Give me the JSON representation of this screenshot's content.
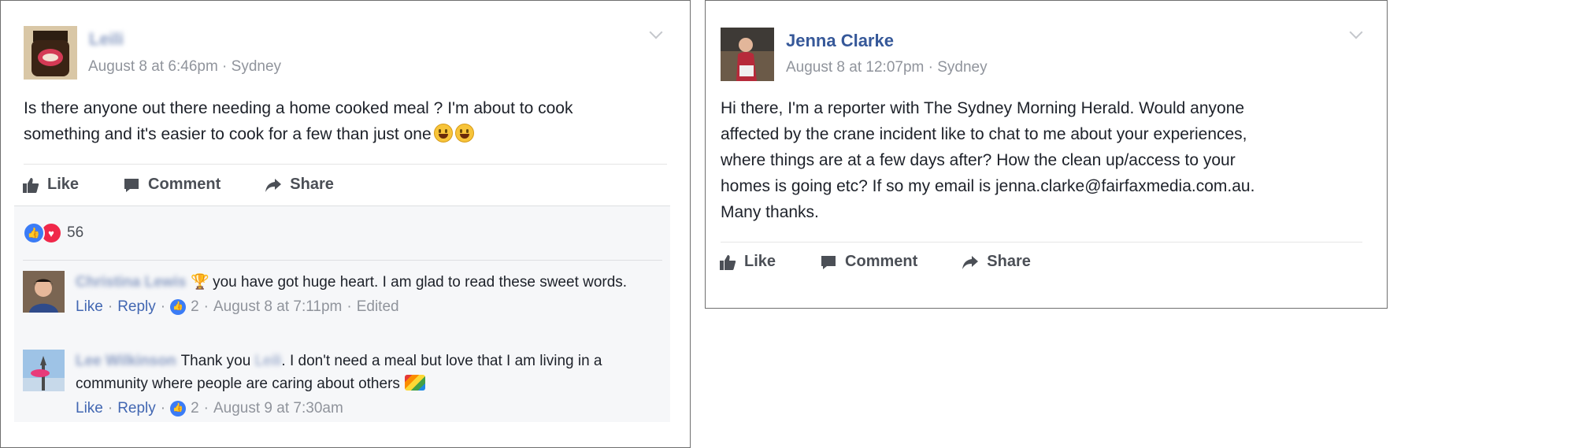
{
  "post1": {
    "author": "Leili",
    "meta": "August 8 at 6:46pm · Sydney",
    "text": "Is there anyone out there needing a home cooked meal ? I'm about to cook\nsomething and it's easier to cook for a few than just one",
    "actions": {
      "like": "Like",
      "comment": "Comment",
      "share": "Share"
    },
    "reaction_count": "56",
    "comments": [
      {
        "author": "Christina Lewis",
        "text": "you have got huge heart. I am glad to read these sweet words.",
        "like": "Like",
        "reply": "Reply",
        "likes": "2",
        "time": "August 8 at 7:11pm",
        "edited": "Edited"
      },
      {
        "author": "Lee Wilkinson",
        "text_prefix": "Thank you",
        "mention": "Leili",
        "text": ". I don't need a meal but love that I am living in a community where people are caring about others",
        "like": "Like",
        "reply": "Reply",
        "likes": "2",
        "time": "August 9 at 7:30am"
      }
    ]
  },
  "post2": {
    "author": "Jenna Clarke",
    "meta": "August 8 at 12:07pm · Sydney",
    "text": "Hi there, I'm a reporter with The Sydney Morning Herald. Would anyone\naffected by the crane incident like to chat to me about your experiences,\nwhere things are at a few days after? How the clean up/access to your\nhomes is going etc? If so my email is jenna.clarke@fairfaxmedia.com.au.\nMany thanks.",
    "actions": {
      "like": "Like",
      "comment": "Comment",
      "share": "Share"
    }
  },
  "icons": {
    "like": "thumbs-up-icon",
    "comment": "speech-bubble-icon",
    "share": "share-arrow-icon",
    "chevron": "chevron-down-icon"
  },
  "colors": {
    "link": "#365899",
    "meta": "#90949c",
    "like_blue": "#3b7cf6",
    "love_red": "#f0284a"
  }
}
